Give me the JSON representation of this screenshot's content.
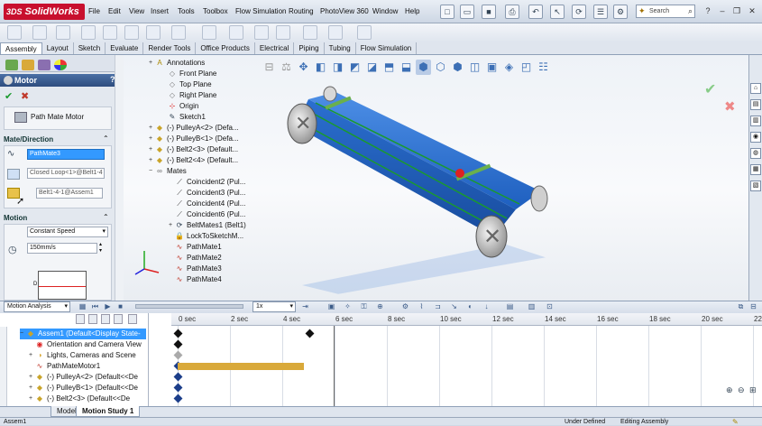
{
  "app": {
    "logo_text": "SolidWorks",
    "logo_prefix": "3DS"
  },
  "menu": [
    "File",
    "Edit",
    "View",
    "Insert",
    "Tools",
    "Toolbox",
    "Flow Simulation",
    "Routing",
    "PhotoView 360",
    "Window",
    "Help"
  ],
  "search": {
    "placeholder": "Search"
  },
  "tabs": [
    "Assembly",
    "Layout",
    "Sketch",
    "Evaluate",
    "Render Tools",
    "Office Products",
    "Electrical",
    "Piping",
    "Tubing",
    "Flow Simulation"
  ],
  "property_manager": {
    "title": "Motor",
    "motor_type": "Path Mate Motor",
    "mate_direction": {
      "header": "Mate/Direction",
      "mate_field": "PathMate3",
      "path_field": "Closed Loop<1>@Belt1-4",
      "component_field": "Belt1-4-1@Assem1"
    },
    "motion": {
      "header": "Motion",
      "type": "Constant Speed",
      "speed": "150mm/s",
      "graph_label": "D"
    }
  },
  "feature_tree": [
    {
      "label": "Annotations",
      "icon": "annotations-icon",
      "expand": "+"
    },
    {
      "label": "Front Plane",
      "icon": "plane-icon",
      "expand": ""
    },
    {
      "label": "Top Plane",
      "icon": "plane-icon",
      "expand": ""
    },
    {
      "label": "Right Plane",
      "icon": "plane-icon",
      "expand": ""
    },
    {
      "label": "Origin",
      "icon": "origin-icon",
      "expand": ""
    },
    {
      "label": "Sketch1",
      "icon": "sketch-icon",
      "expand": ""
    },
    {
      "label": "(-) PulleyA<2> (Defa...",
      "icon": "part-icon",
      "expand": "+"
    },
    {
      "label": "(-) PulleyB<1> (Defa...",
      "icon": "part-icon",
      "expand": "+"
    },
    {
      "label": "(-) Belt2<3> (Default...",
      "icon": "part-icon",
      "expand": "+"
    },
    {
      "label": "(-) Belt2<4> (Default...",
      "icon": "part-icon",
      "expand": "+"
    },
    {
      "label": "Mates",
      "icon": "mates-icon",
      "expand": "−"
    },
    {
      "label": "Coincident2 (Pul...",
      "icon": "coincident-icon",
      "expand": ""
    },
    {
      "label": "Coincident3 (Pul...",
      "icon": "coincident-icon",
      "expand": ""
    },
    {
      "label": "Coincident4 (Pul...",
      "icon": "coincident-icon",
      "expand": ""
    },
    {
      "label": "Coincident6 (Pul...",
      "icon": "coincident-icon",
      "expand": ""
    },
    {
      "label": "BeltMates1 (Belt1)",
      "icon": "beltmate-icon",
      "expand": "+"
    },
    {
      "label": "LockToSketchM...",
      "icon": "lock-icon",
      "expand": ""
    },
    {
      "label": "PathMate1",
      "icon": "pathmate-icon",
      "expand": ""
    },
    {
      "label": "PathMate2",
      "icon": "pathmate-icon",
      "expand": ""
    },
    {
      "label": "PathMate3",
      "icon": "pathmate-icon",
      "expand": ""
    },
    {
      "label": "PathMate4",
      "icon": "pathmate-icon",
      "expand": ""
    }
  ],
  "motion_manager": {
    "study_type": "Motion Analysis",
    "zoom": "1x",
    "tree": [
      {
        "label": "Assem1  (Default<Display State-",
        "expand": "−"
      },
      {
        "label": "Orientation and Camera View",
        "expand": ""
      },
      {
        "label": "Lights, Cameras and Scene",
        "expand": "+"
      },
      {
        "label": "PathMateMotor1",
        "expand": ""
      },
      {
        "label": "(-) PulleyA<2> (Default<<De",
        "expand": "+"
      },
      {
        "label": "(-) PulleyB<1> (Default<<De",
        "expand": "+"
      },
      {
        "label": "(-) Belt2<3> (Default<<De",
        "expand": "+"
      }
    ],
    "time_ticks": [
      "0 sec",
      "2 sec",
      "4 sec",
      "6 sec",
      "8 sec",
      "10 sec",
      "12 sec",
      "14 sec",
      "16 sec",
      "18 sec",
      "20 sec",
      "22"
    ],
    "motor_bar_end_sec": 5
  },
  "bottom_tabs": [
    "Model",
    "Motion Study 1"
  ],
  "status": {
    "left": "Assem1",
    "state": "Under Defined",
    "mode": "Editing Assembly"
  },
  "colors": {
    "accent": "#2f5e9e",
    "belt": "#2a6fd1",
    "motor_bar": "#d9a93a",
    "pathmate": "#c0392b"
  }
}
